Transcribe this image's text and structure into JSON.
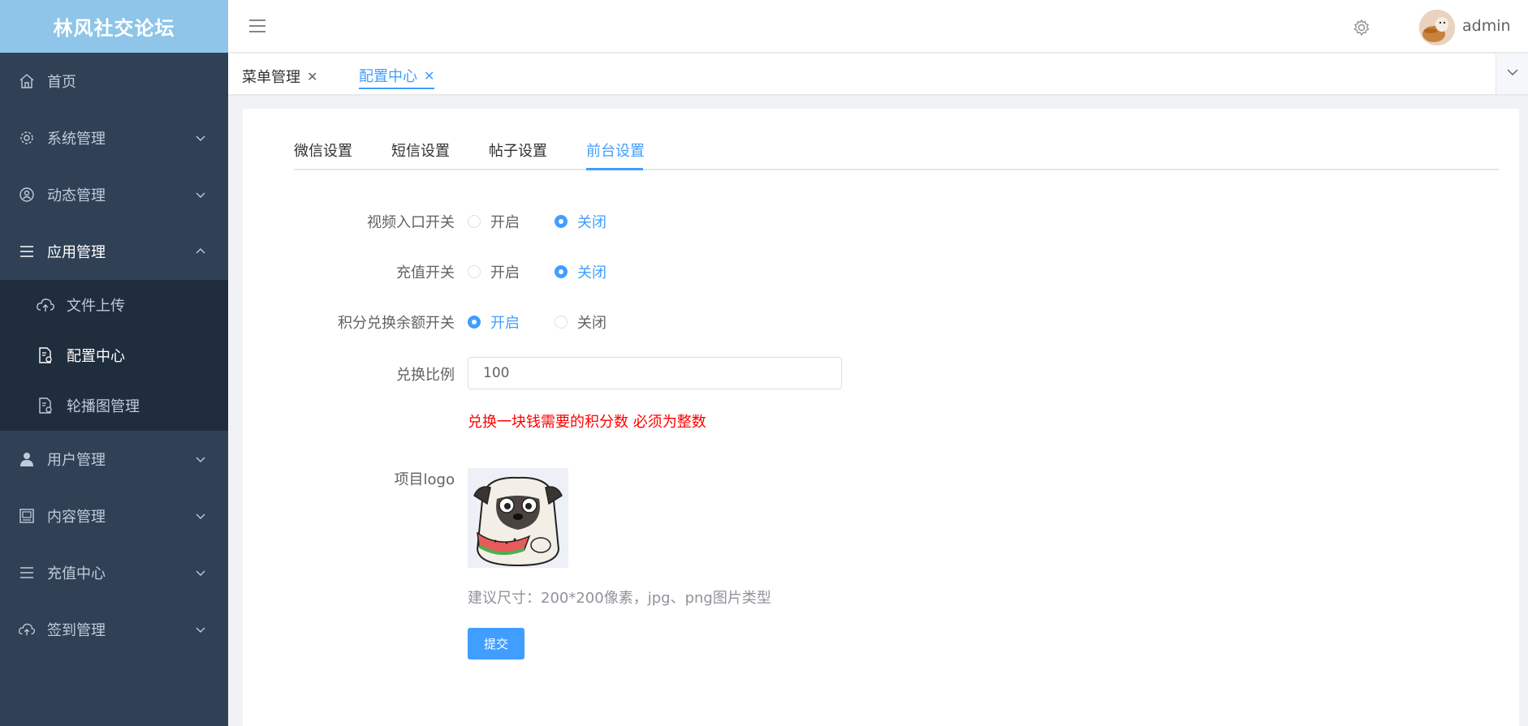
{
  "app": {
    "title": "林风社交论坛"
  },
  "sidebar": {
    "items": [
      {
        "label": "首页",
        "icon": "home-icon"
      },
      {
        "label": "系统管理",
        "icon": "gear-icon"
      },
      {
        "label": "动态管理",
        "icon": "user-circle-icon"
      },
      {
        "label": "应用管理",
        "icon": "list-icon",
        "expanded": true
      },
      {
        "label": "用户管理",
        "icon": "user-icon"
      },
      {
        "label": "内容管理",
        "icon": "picture-icon"
      },
      {
        "label": "充值中心",
        "icon": "list-icon"
      },
      {
        "label": "签到管理",
        "icon": "cloud-upload-icon"
      }
    ],
    "submenu": [
      {
        "label": "文件上传",
        "icon": "cloud-upload-icon"
      },
      {
        "label": "配置中心",
        "icon": "document-gear-icon",
        "active": true
      },
      {
        "label": "轮播图管理",
        "icon": "document-gear-icon"
      }
    ]
  },
  "header": {
    "username": "admin"
  },
  "tagsbar": {
    "tags": [
      {
        "label": "菜单管理",
        "active": false
      },
      {
        "label": "配置中心",
        "active": true
      }
    ]
  },
  "tabs": [
    {
      "label": "微信设置",
      "active": false
    },
    {
      "label": "短信设置",
      "active": false
    },
    {
      "label": "帖子设置",
      "active": false
    },
    {
      "label": "前台设置",
      "active": true
    }
  ],
  "form": {
    "video_switch": {
      "label": "视频入口开关",
      "on": "开启",
      "off": "关闭",
      "value": "off"
    },
    "recharge_switch": {
      "label": "充值开关",
      "on": "开启",
      "off": "关闭",
      "value": "off"
    },
    "points_switch": {
      "label": "积分兑换余额开关",
      "on": "开启",
      "off": "关闭",
      "value": "on"
    },
    "ratio": {
      "label": "兑换比例",
      "value": "100",
      "hint": "兑换一块钱需要的积分数 必须为整数"
    },
    "logo": {
      "label": "项目logo",
      "hint": "建议尺寸：200*200像素，jpg、png图片类型"
    },
    "submit_label": "提交"
  },
  "colors": {
    "accent": "#409eff",
    "sidebar_bg": "#304156",
    "logo_bg": "#8ec5e8",
    "error": "#ff0000"
  }
}
